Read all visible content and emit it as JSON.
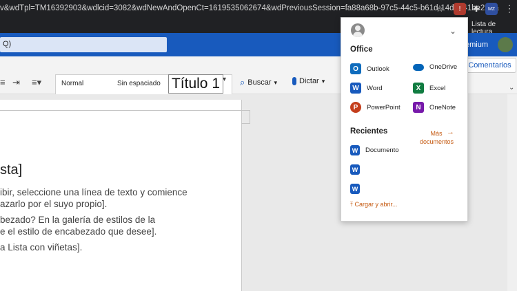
{
  "browser": {
    "url": "v&wdTpl=TM16392903&wdlcid=3082&wdNewAndOpenCt=1619535062674&wdPreviousSession=fa88a68b-97c5-44c5-b61d-14d5541be22e&",
    "reading_list": "Lista de lectura"
  },
  "word": {
    "search_placeholder": "Q)",
    "premium_label": "emium"
  },
  "ribbon": {
    "style_normal": "Normal",
    "style_sin_espaciado": "Sin espaciado",
    "style_titulo": "Título 1",
    "buscar": "Buscar",
    "dictar": "Dictar",
    "comentarios": "Comentarios"
  },
  "document": {
    "heading": "sta]",
    "lines": [
      "ibir, seleccione una línea de texto y comience",
      "azarlo por el suyo propio].",
      "bezado? En la galería de estilos de la",
      "e el estilo de encabezado que desee].",
      "a Lista con viñetas]."
    ]
  },
  "launcher": {
    "office_title": "Office",
    "apps": {
      "outlook": "Outlook",
      "onedrive": "OneDrive",
      "word": "Word",
      "excel": "Excel",
      "powerpoint": "PowerPoint",
      "onenote": "OneNote"
    },
    "recientes_title": "Recientes",
    "mas_documentos": "Más documentos",
    "recent_docs": [
      "Documento",
      "",
      ""
    ],
    "cargar": "Cargar y abrir..."
  },
  "colors": {
    "word_blue": "#185abd",
    "link_orange": "#c55a11",
    "outlook": "#0f6cbd",
    "onedrive": "#0364b8",
    "word": "#185abd",
    "excel": "#107c41",
    "powerpoint": "#c43e1c",
    "onenote": "#7719aa"
  }
}
